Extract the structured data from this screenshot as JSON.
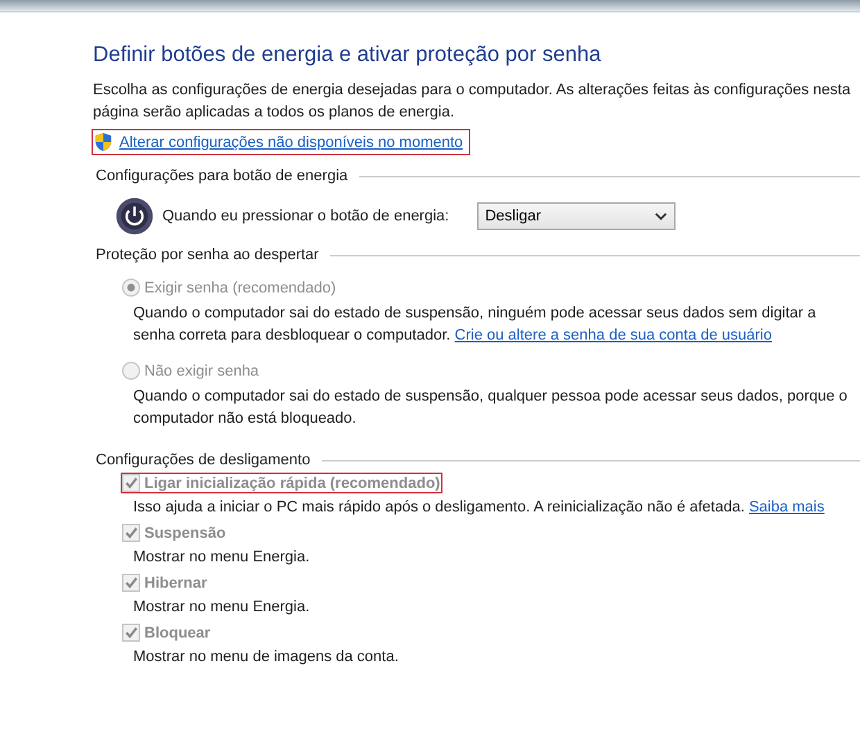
{
  "title": "Definir botões de energia e ativar proteção por senha",
  "intro": "Escolha as configurações de energia desejadas para o computador. As alterações feitas às configurações nesta página serão aplicadas a todos os planos de energia.",
  "admin_link": {
    "label": "Alterar configurações não disponíveis no momento",
    "highlighted": true
  },
  "power_section": {
    "heading": "Configurações para botão de energia",
    "label": "Quando eu pressionar o botão de energia:",
    "dropdown": {
      "value": "Desligar"
    }
  },
  "password_section": {
    "heading": "Proteção por senha ao despertar",
    "options": [
      {
        "label": "Exigir senha (recomendado)",
        "selected": true,
        "disabled": true,
        "description": "Quando o computador sai do estado de suspensão, ninguém pode acessar seus dados sem digitar a senha correta para desbloquear o computador.",
        "link": "Crie ou altere a senha de sua conta de usuário"
      },
      {
        "label": "Não exigir senha",
        "selected": false,
        "disabled": true,
        "description": "Quando o computador sai do estado de suspensão, qualquer pessoa pode acessar seus dados, porque o computador não está bloqueado."
      }
    ]
  },
  "shutdown_section": {
    "heading": "Configurações de desligamento",
    "options": [
      {
        "label": "Ligar inicialização rápida (recomendado)",
        "checked": true,
        "disabled": true,
        "highlighted": true,
        "description": "Isso ajuda a iniciar o PC mais rápido após o desligamento. A reinicialização não é afetada.",
        "link": "Saiba mais"
      },
      {
        "label": "Suspensão",
        "checked": true,
        "disabled": true,
        "highlighted": false,
        "description": "Mostrar no menu Energia."
      },
      {
        "label": "Hibernar",
        "checked": true,
        "disabled": true,
        "highlighted": false,
        "description": "Mostrar no menu Energia."
      },
      {
        "label": "Bloquear",
        "checked": true,
        "disabled": true,
        "highlighted": false,
        "description": "Mostrar no menu de imagens da conta."
      }
    ]
  }
}
